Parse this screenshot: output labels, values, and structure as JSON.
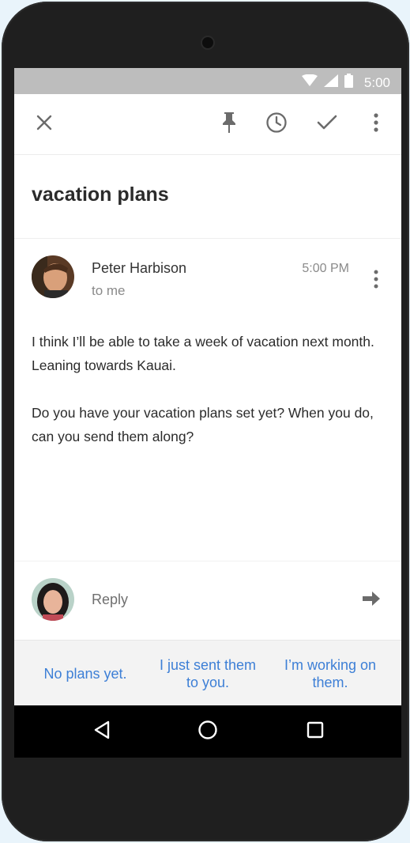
{
  "status_bar": {
    "time": "5:00",
    "icons": [
      "wifi-icon",
      "signal-icon",
      "battery-icon"
    ]
  },
  "toolbar": {
    "actions": [
      "close-icon",
      "pin-icon",
      "snooze-clock-icon",
      "done-check-icon",
      "more-vert-icon"
    ]
  },
  "thread": {
    "subject": "vacation plans"
  },
  "message": {
    "sender": "Peter Harbison",
    "recipient": "to me",
    "time": "5:00 PM",
    "body": [
      "I think I’ll be able to take a week of vacation next month. Leaning towards Kauai.",
      "Do you have your vacation plans set yet? When you do, can you send them along?"
    ]
  },
  "reply": {
    "placeholder": "Reply"
  },
  "smart_replies": [
    "No plans yet.",
    "I just sent them to you.",
    "I’m working on them."
  ],
  "nav_bar": {
    "buttons": [
      "back-icon",
      "home-icon",
      "recents-icon"
    ]
  },
  "colors": {
    "accent": "#3d7fd6",
    "status_bar": "#bdbdbd",
    "phone_body": "#1f1f1f",
    "background": "#e9f4fb"
  }
}
